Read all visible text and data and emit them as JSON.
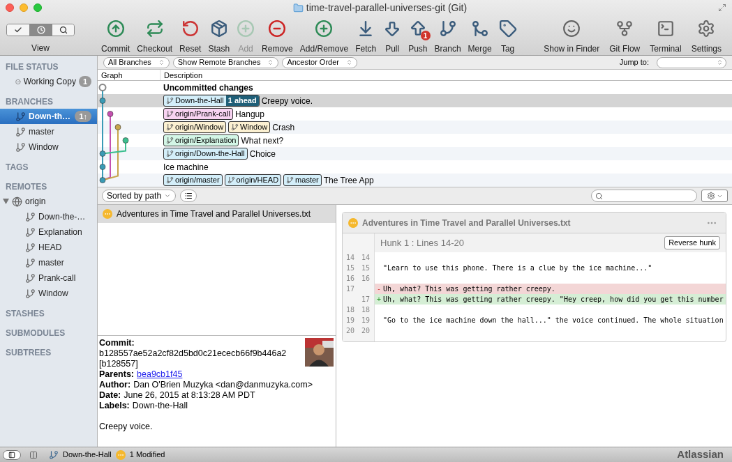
{
  "window": {
    "title": "time-travel-parallel-universes-git (Git)"
  },
  "toolbar": {
    "view_label": "View",
    "view_modes": [
      {
        "kind": "check",
        "selected": false
      },
      {
        "kind": "clock",
        "selected": true
      },
      {
        "kind": "search",
        "selected": false
      }
    ],
    "buttons": [
      {
        "kind": "commit",
        "label": "Commit",
        "disabled": false
      },
      {
        "kind": "checkout",
        "label": "Checkout",
        "disabled": false
      },
      {
        "kind": "reset",
        "label": "Reset",
        "disabled": false
      },
      {
        "kind": "stash",
        "label": "Stash",
        "disabled": false
      },
      {
        "kind": "add",
        "label": "Add",
        "disabled": true
      },
      {
        "kind": "remove",
        "label": "Remove",
        "disabled": false
      },
      {
        "kind": "addremove",
        "label": "Add/Remove",
        "disabled": false
      },
      {
        "kind": "fetch",
        "label": "Fetch",
        "disabled": false
      },
      {
        "kind": "pull",
        "label": "Pull",
        "disabled": false
      },
      {
        "kind": "push",
        "label": "Push",
        "disabled": false,
        "badge": "1"
      },
      {
        "kind": "branch",
        "label": "Branch",
        "disabled": false
      },
      {
        "kind": "merge",
        "label": "Merge",
        "disabled": false
      },
      {
        "kind": "tag",
        "label": "Tag",
        "disabled": false
      }
    ],
    "right_buttons": [
      {
        "kind": "finder",
        "label": "Show in Finder"
      },
      {
        "kind": "gitflow",
        "label": "Git Flow"
      },
      {
        "kind": "terminal",
        "label": "Terminal"
      },
      {
        "kind": "settings",
        "label": "Settings"
      }
    ]
  },
  "sidebar": {
    "sections": [
      {
        "title": "FILE STATUS",
        "items": [
          {
            "kind": "working",
            "label": "Working Copy",
            "badge": "1",
            "selected": false
          }
        ]
      },
      {
        "title": "BRANCHES",
        "items": [
          {
            "kind": "branch",
            "label": "Down-th…",
            "badge": "1↑",
            "selected": true
          },
          {
            "kind": "branch",
            "label": "master",
            "selected": false
          },
          {
            "kind": "branch",
            "label": "Window",
            "selected": false
          }
        ]
      },
      {
        "title": "TAGS"
      },
      {
        "title": "REMOTES",
        "items": [
          {
            "kind": "remote",
            "label": "origin",
            "expanded": true,
            "selected": false,
            "children": [
              {
                "kind": "branch",
                "label": "Down-the-…",
                "selected": false
              },
              {
                "kind": "branch",
                "label": "Explanation",
                "selected": false
              },
              {
                "kind": "branch",
                "label": "HEAD",
                "selected": false
              },
              {
                "kind": "branch",
                "label": "master",
                "selected": false
              },
              {
                "kind": "branch",
                "label": "Prank-call",
                "selected": false
              },
              {
                "kind": "branch",
                "label": "Window",
                "selected": false
              }
            ]
          }
        ]
      },
      {
        "title": "STASHES"
      },
      {
        "title": "SUBMODULES"
      },
      {
        "title": "SUBTREES"
      }
    ]
  },
  "filters": {
    "dropdowns": [
      "All Branches",
      "Show Remote Branches",
      "Ancestor Order"
    ],
    "jump_to_label": "Jump to:"
  },
  "history": {
    "columns": [
      "Graph",
      "Description"
    ],
    "commits": [
      {
        "kind": "uncommitted",
        "color": "#888888",
        "description": "Uncommitted changes",
        "selected": false
      },
      {
        "kind": "commit",
        "color": "#3a9bb5",
        "description": "Creepy voice.",
        "selected": true,
        "labels": [
          {
            "text": "Down-the-Hall",
            "color": "#d3eef9",
            "ahead": "1 ahead"
          }
        ]
      },
      {
        "kind": "commit",
        "color": "#c550b0",
        "description": "Hangup",
        "selected": false,
        "labels": [
          {
            "text": "origin/Prank-call",
            "color": "#f8d3f2"
          }
        ]
      },
      {
        "kind": "commit",
        "color": "#c7a54c",
        "description": "Crash",
        "selected": false,
        "labels": [
          {
            "text": "origin/Window",
            "color": "#fbf0d1"
          },
          {
            "text": "Window",
            "color": "#fbf0d1"
          }
        ]
      },
      {
        "kind": "commit",
        "color": "#3cbf8f",
        "description": "What next?",
        "selected": false,
        "labels": [
          {
            "text": "origin/Explanation",
            "color": "#d3f6e6"
          }
        ]
      },
      {
        "kind": "commit",
        "color": "#3a9bb5",
        "description": "Choice",
        "selected": false,
        "labels": [
          {
            "text": "origin/Down-the-Hall",
            "color": "#d3eef9"
          }
        ]
      },
      {
        "kind": "commit",
        "color": "#3a9bb5",
        "description": "Ice machine",
        "selected": false
      },
      {
        "kind": "commit",
        "color": "#3a9bb5",
        "description": "The Tree App",
        "selected": false,
        "labels": [
          {
            "text": "origin/master",
            "color": "#d3eef9"
          },
          {
            "text": "origin/HEAD",
            "color": "#d3eef9"
          },
          {
            "text": "master",
            "color": "#d3eef9"
          }
        ]
      }
    ]
  },
  "files": {
    "sort": "Sorted by path",
    "items": [
      {
        "name": "Adventures in Time Travel and Parallel Universes.txt",
        "modified": true,
        "selected": true
      }
    ]
  },
  "commit_details": {
    "commit_label": "Commit:",
    "hash": "b128557ae52a2cf82d5bd0c21ececb66f9b446a2",
    "short_hash": "[b128557]",
    "parents_label": "Parents:",
    "parents": "bea9cb1f45",
    "author_label": "Author:",
    "author": "Dan O'Brien Muzyka <dan@danmuzyka.com>",
    "date_label": "Date:",
    "date": "June 26, 2015 at 8:13:28 AM PDT",
    "labels_label": "Labels:",
    "labels": "Down-the-Hall",
    "message": "Creepy voice."
  },
  "diff": {
    "file": "Adventures in Time Travel and Parallel Universes.txt",
    "modified": true,
    "hunk": "Hunk 1 : Lines 14-20",
    "reverse_button": "Reverse hunk",
    "lines": [
      {
        "kind": "context",
        "old": "14",
        "new": "14"
      },
      {
        "kind": "context",
        "old": "15",
        "new": "15",
        "text": "\"Learn to use this phone. There is a clue by the ice machine...\""
      },
      {
        "kind": "context",
        "old": "16",
        "new": "16"
      },
      {
        "kind": "removed",
        "old": "17",
        "sign": "-",
        "text": "Uh, what? This was getting rather creepy."
      },
      {
        "kind": "added",
        "new": "17",
        "sign": "+",
        "text": "Uh, what? This was getting rather creepy. \"Hey creep, how did you get this number"
      },
      {
        "kind": "context",
        "old": "18",
        "new": "18"
      },
      {
        "kind": "context",
        "old": "19",
        "new": "19",
        "text": "\"Go to the ice machine down the hall...\" the voice continued. The whole situation"
      },
      {
        "kind": "context",
        "old": "20",
        "new": "20"
      }
    ]
  },
  "status_bar": {
    "branch": "Down-the-Hall",
    "modified": true,
    "changes": "1 Modified",
    "brand": "Atlassian"
  }
}
